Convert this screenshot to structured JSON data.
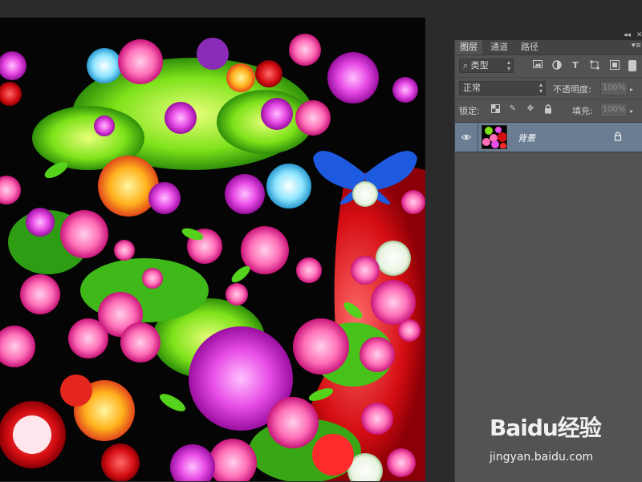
{
  "panel": {
    "tabs": [
      {
        "label": "图层",
        "active": true
      },
      {
        "label": "通道",
        "active": false
      },
      {
        "label": "路径",
        "active": false
      }
    ],
    "filter": {
      "label": "⌕ 类型"
    },
    "blend_mode": "正常",
    "opacity": {
      "label": "不透明度:",
      "value": "100%"
    },
    "lock": {
      "label": "锁定:"
    },
    "fill": {
      "label": "填充:",
      "value": "100%"
    },
    "layers": [
      {
        "name": "背景",
        "visible": true,
        "locked": true,
        "selected": true
      }
    ]
  },
  "icons": {
    "collapse": "double-chevron-icon",
    "panel_menu": "panel-menu-icon",
    "filter_icons": [
      "image-filter-icon",
      "adjustment-filter-icon",
      "type-filter-icon",
      "shape-filter-icon",
      "smart-object-filter-icon"
    ]
  },
  "watermark": {
    "logo": "Baidu经验",
    "url": "jingyan.baidu.com"
  },
  "colors": {
    "app_bg": "#2b2b2b",
    "panel_bg": "#535353",
    "selected_layer": "#6a7d93",
    "canvas_bg": "#050505"
  }
}
